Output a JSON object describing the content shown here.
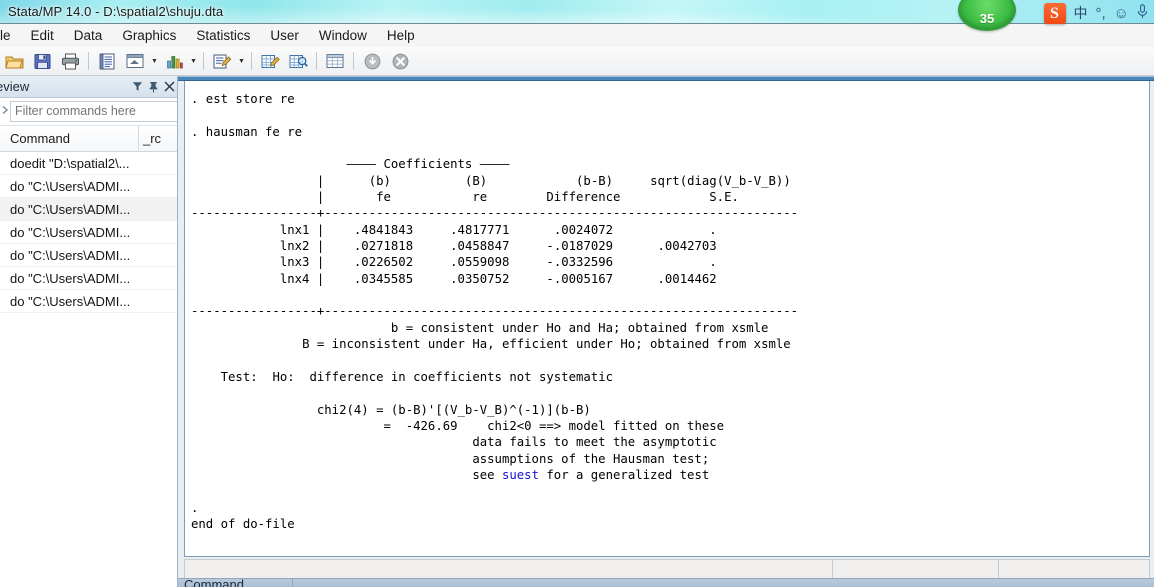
{
  "window": {
    "title": "Stata/MP 14.0 - D:\\spatial2\\shuju.dta",
    "app_name": "Stata/MP 14.0",
    "file_path": "D:\\spatial2\\shuju.dta"
  },
  "ime": {
    "logo_label": "S",
    "lang_label": "中",
    "punct_label": "°,",
    "emoji_label": "☺",
    "mic_label": "ᴖ",
    "badge_count": "35"
  },
  "menu": {
    "items": [
      {
        "label": "ile",
        "name": "menu-file"
      },
      {
        "label": "Edit",
        "name": "menu-edit"
      },
      {
        "label": "Data",
        "name": "menu-data"
      },
      {
        "label": "Graphics",
        "name": "menu-graphics"
      },
      {
        "label": "Statistics",
        "name": "menu-statistics"
      },
      {
        "label": "User",
        "name": "menu-user"
      },
      {
        "label": "Window",
        "name": "menu-window"
      },
      {
        "label": "Help",
        "name": "menu-help"
      }
    ]
  },
  "toolbar": {
    "buttons": [
      {
        "name": "open-icon",
        "glyph": "📂"
      },
      {
        "name": "save-icon",
        "glyph": "💾"
      },
      {
        "name": "print-icon",
        "glyph": "🖨"
      },
      {
        "name": "log-icon",
        "glyph": "📔"
      },
      {
        "name": "viewer-icon",
        "glyph": "🗔"
      },
      {
        "name": "graph-icon",
        "glyph": "📊"
      },
      {
        "name": "do-editor-icon",
        "glyph": "📝"
      },
      {
        "name": "data-editor-edit-icon",
        "glyph": "🗃"
      },
      {
        "name": "data-editor-browse-icon",
        "glyph": "🔍"
      },
      {
        "name": "variables-manager-icon",
        "glyph": "▦"
      },
      {
        "name": "more-icon",
        "glyph": "⬇"
      },
      {
        "name": "break-icon",
        "glyph": "✖"
      }
    ]
  },
  "review": {
    "panel_title": "eview",
    "header_icons": [
      {
        "name": "filter-icon",
        "glyph": "▼"
      },
      {
        "name": "pin-icon",
        "glyph": "📌"
      },
      {
        "name": "close-icon",
        "glyph": "✕"
      }
    ],
    "filter_placeholder": "Filter commands here",
    "filter_value": "",
    "info_label": "!",
    "columns": {
      "command": "Command",
      "rc": "_rc"
    },
    "rows": [
      {
        "command": "doedit \"D:\\spatial2\\...",
        "rc": ""
      },
      {
        "command": "do \"C:\\Users\\ADMI...",
        "rc": ""
      },
      {
        "command": "do \"C:\\Users\\ADMI...",
        "rc": ""
      },
      {
        "command": "do \"C:\\Users\\ADMI...",
        "rc": ""
      },
      {
        "command": "do \"C:\\Users\\ADMI...",
        "rc": ""
      },
      {
        "command": "do \"C:\\Users\\ADMI...",
        "rc": ""
      },
      {
        "command": "do \"C:\\Users\\ADMI...",
        "rc": ""
      }
    ],
    "selected_row_index": 2
  },
  "results": {
    "command_1": ". est store re",
    "command_2": ". hausman fe re",
    "coefficients_label": "Coefficients",
    "table": {
      "header_line_1": [
        "(b)",
        "(B)",
        "(b-B)",
        "sqrt(diag(V_b-V_B))"
      ],
      "header_line_2": [
        "fe",
        "re",
        "Difference",
        "S.E."
      ],
      "rows": [
        {
          "var": "lnx1",
          "b": ".4841843",
          "B": ".4817771",
          "diff": ".0024072",
          "se": "."
        },
        {
          "var": "lnx2",
          "b": ".0271818",
          "B": ".0458847",
          "diff": "-.0187029",
          "se": ".0042703"
        },
        {
          "var": "lnx3",
          "b": ".0226502",
          "B": ".0559098",
          "diff": "-.0332596",
          "se": "."
        },
        {
          "var": "lnx4",
          "b": ".0345585",
          "B": ".0350752",
          "diff": "-.0005167",
          "se": ".0014462"
        }
      ]
    },
    "note_b": "b = consistent under Ho and Ha; obtained from xsmle",
    "note_B": "B = inconsistent under Ha, efficient under Ho; obtained from xsmle",
    "test_line": "Test:  Ho:  difference in coefficients not systematic",
    "chi2_label": "chi2(4) = (b-B)'[(V_b-V_B)^(-1)](b-B)",
    "chi2_value": "-426.69",
    "chi2_note_1": "chi2<0 ==> model fitted on these",
    "chi2_note_2": "data fails to meet the asymptotic",
    "chi2_note_3": "assumptions of the Hausman test;",
    "chi2_note_4_pre": "see ",
    "chi2_note_4_link": "suest",
    "chi2_note_4_post": " for a generalized test",
    "prompt_dot": ".",
    "end_of_dofile": "end of do-file",
    "final_prompt": "."
  },
  "command_panel": {
    "title": "Command"
  },
  "colors": {
    "title_bar_accent": "#8fe6ea",
    "results_header_blue": "#4c87b8",
    "link_blue": "#1515d0",
    "badge_green": "#3fbf45",
    "ime_orange": "#ef4a15"
  }
}
